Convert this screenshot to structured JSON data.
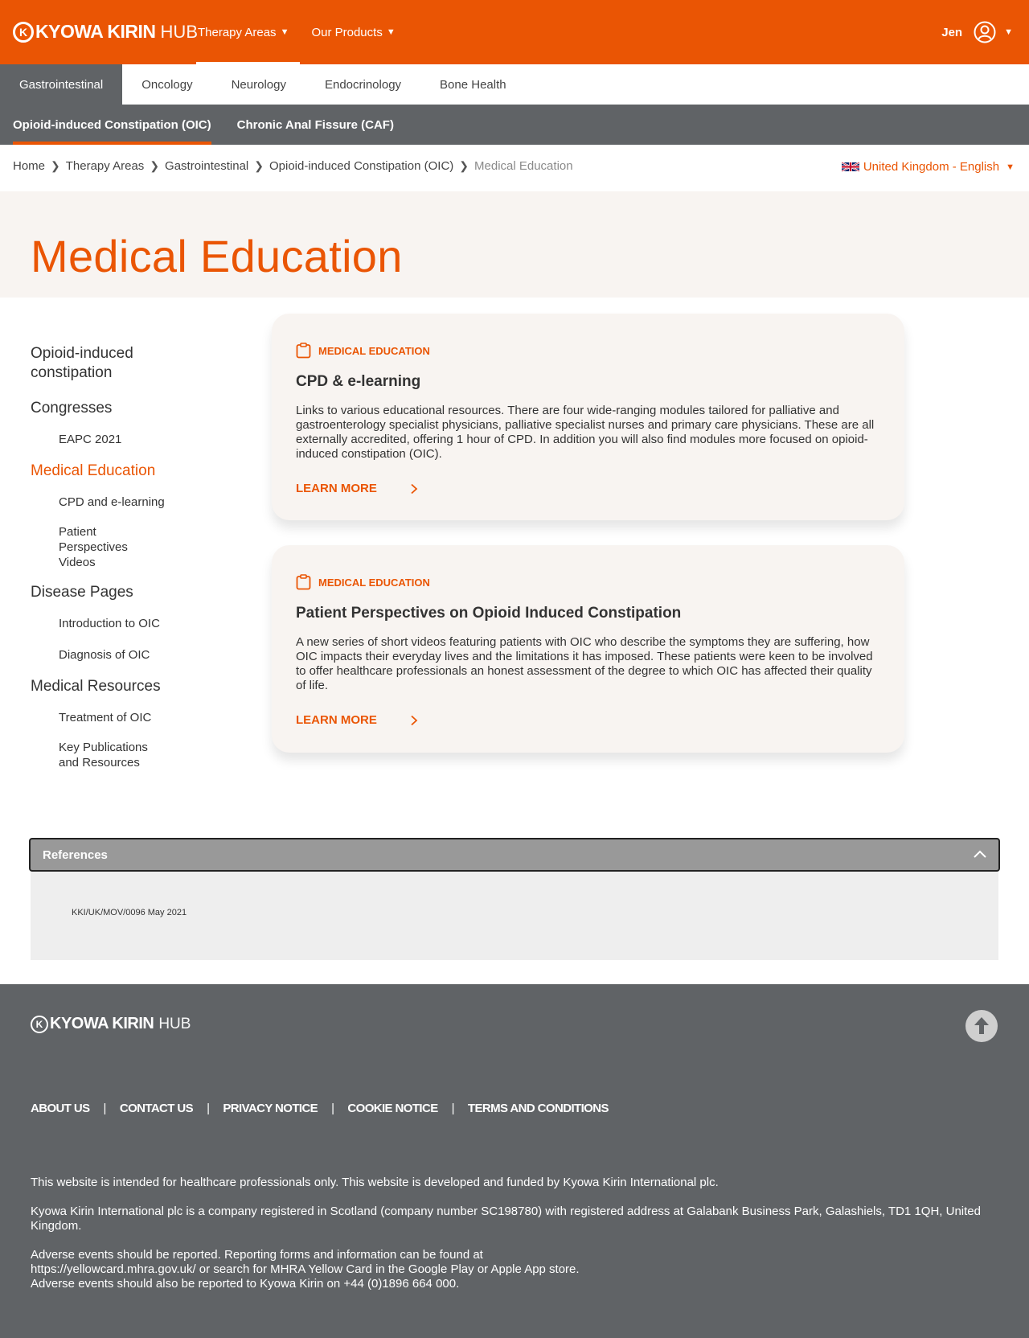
{
  "header": {
    "logo_main": "KYOWA KIRIN",
    "logo_badge": "K",
    "logo_hub": "HUB",
    "nav": [
      {
        "label": "Therapy Areas"
      },
      {
        "label": "Our Products"
      }
    ],
    "user_name": "Jen"
  },
  "tabs": [
    "Gastrointestinal",
    "Oncology",
    "Neurology",
    "Endocrinology",
    "Bone Health"
  ],
  "subtabs": [
    "Opioid-induced Constipation (OIC)",
    "Chronic Anal Fissure (CAF)"
  ],
  "breadcrumb": [
    "Home",
    "Therapy Areas",
    "Gastrointestinal",
    "Opioid-induced Constipation (OIC)",
    "Medical Education"
  ],
  "locale": "United Kingdom - English",
  "page_title": "Medical Education",
  "sidebar": {
    "s1": "Opioid-induced constipation",
    "s2": "Congresses",
    "s2a": "EAPC 2021",
    "s3": "Medical Education",
    "s3a": "CPD and e-learning",
    "s3b": "Patient Perspectives Videos",
    "s4": "Disease Pages",
    "s4a": "Introduction to OIC",
    "s4b": "Diagnosis of OIC",
    "s5": "Medical Resources",
    "s5a": "Treatment of OIC",
    "s5b": "Key Publications and Resources"
  },
  "cards": [
    {
      "tag": "MEDICAL EDUCATION",
      "title": "CPD & e-learning",
      "text": "Links to various educational resources. There are four wide-ranging modules tailored for palliative and gastroenterology specialist physicians, palliative specialist nurses and primary care physicians. These are all externally accredited, offering 1 hour of CPD. In addition you will also find modules more focused on opioid-induced constipation (OIC).",
      "link": "LEARN MORE"
    },
    {
      "tag": "MEDICAL EDUCATION",
      "title": "Patient Perspectives on Opioid Induced Constipation",
      "text": "A new series of short videos featuring patients with OIC who describe the symptoms they are suffering, how OIC impacts their everyday lives and the limitations it has imposed. These patients were keen to be involved to offer healthcare professionals an honest assessment of the degree to which OIC has affected their quality of life.",
      "link": "LEARN MORE"
    }
  ],
  "references": {
    "label": "References",
    "code": "KKI/UK/MOV/0096  May 2021"
  },
  "footer": {
    "links": [
      "ABOUT US",
      "CONTACT US",
      "PRIVACY NOTICE",
      "COOKIE NOTICE",
      "TERMS AND CONDITIONS"
    ],
    "note1": "This website is intended for healthcare professionals only. This website is developed and funded by Kyowa Kirin International plc.",
    "note2": "Kyowa Kirin International plc is a company registered in Scotland (company number SC198780) with registered address at Galabank Business Park, Galashiels, TD1 1QH, United Kingdom.",
    "note3a": "Adverse events should be reported. Reporting forms and information can be found at",
    "note3b": "https://yellowcard.mhra.gov.uk/ or search for MHRA Yellow Card in the Google Play or Apple App store.",
    "note3c": "Adverse events should also be reported to Kyowa Kirin on +44 (0)1896 664 000."
  },
  "colors": {
    "brand_orange": "#ea5504",
    "nav_grey": "#606366",
    "hero_bg": "#f8f4f1"
  }
}
